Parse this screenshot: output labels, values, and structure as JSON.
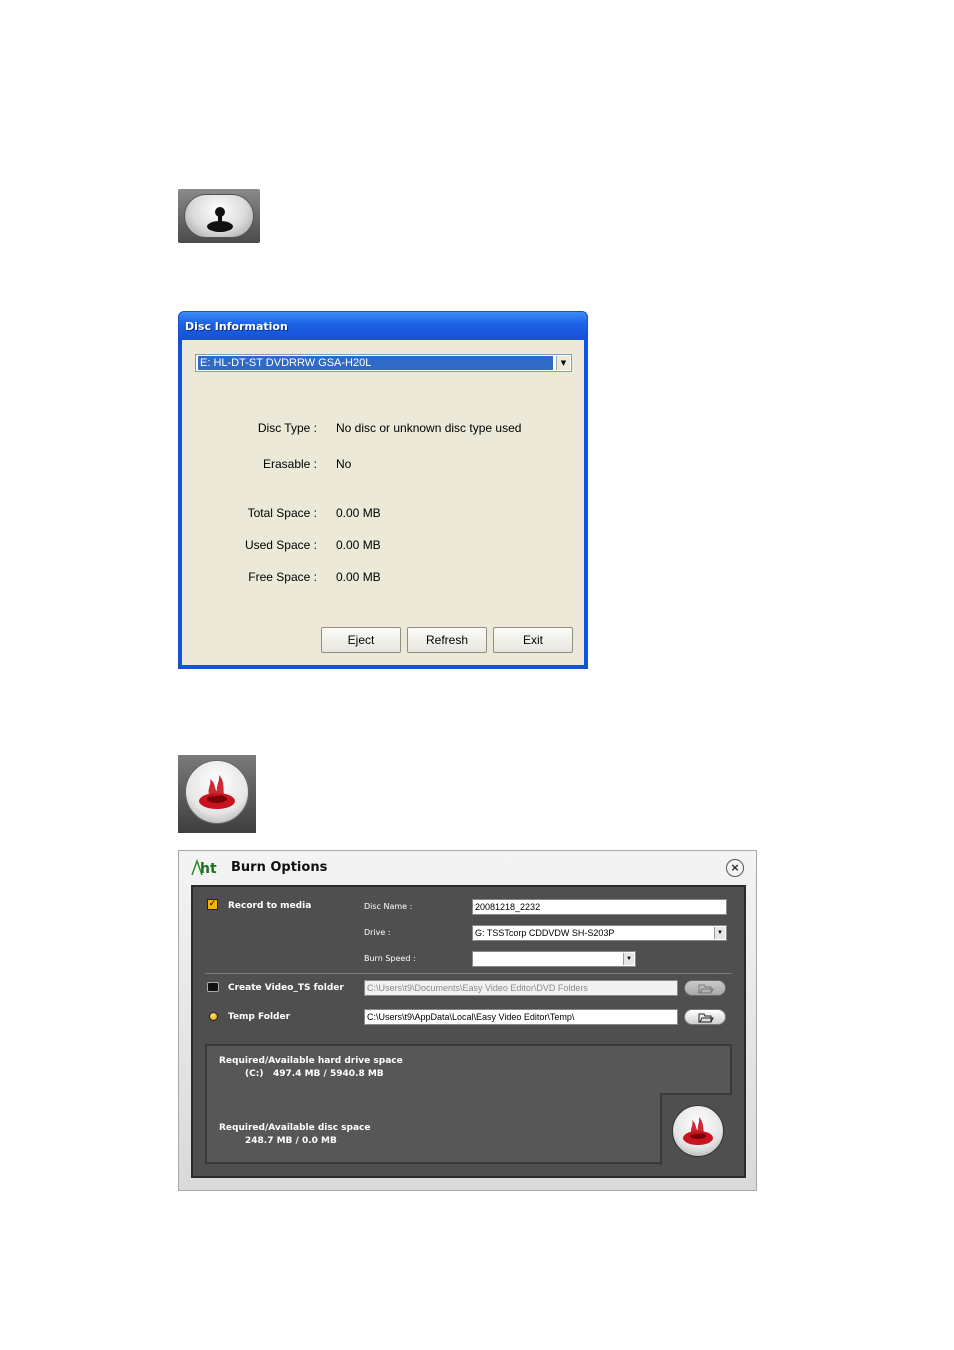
{
  "icons": {
    "disc_info": "disc-info-icon",
    "burn": "burn-flame-icon"
  },
  "disc_info_window": {
    "title": "Disc Information",
    "drive": "E: HL-DT-ST DVDRRW GSA-H20L",
    "labels": {
      "disc_type": "Disc Type :",
      "erasable": "Erasable :",
      "total_space": "Total Space :",
      "used_space": "Used Space :",
      "free_space": "Free Space :"
    },
    "values": {
      "disc_type": "No disc or unknown disc type used",
      "erasable": "No",
      "total_space": "0.00 MB",
      "used_space": "0.00 MB",
      "free_space": "0.00 MB"
    },
    "buttons": {
      "eject": "Eject",
      "refresh": "Refresh",
      "exit": "Exit"
    }
  },
  "burn_options": {
    "title": "Burn Options",
    "logo_text": "ht",
    "close_glyph": "×",
    "record_to_media": {
      "label": "Record to media",
      "checked": true
    },
    "disc_name": {
      "label": "Disc Name :",
      "value": "20081218_2232"
    },
    "drive": {
      "label": "Drive :",
      "value": "G: TSSTcorp CDDVDW SH-S203P"
    },
    "burn_speed": {
      "label": "Burn Speed :",
      "value": ""
    },
    "create_video_ts": {
      "label": "Create Video_TS folder",
      "path": "C:\\Users\\t9\\Documents\\Easy Video Editor\\DVD Folders"
    },
    "temp_folder": {
      "label": "Temp Folder",
      "path": "C:\\Users\\t9\\AppData\\Local\\Easy Video Editor\\Temp\\"
    },
    "hdd_space": {
      "title": "Required/Available hard drive space",
      "drive": "(C:)",
      "value": "497.4 MB / 5940.8 MB"
    },
    "disc_space": {
      "title": "Required/Available disc space",
      "value": "248.7 MB / 0.0 MB"
    }
  },
  "colors": {
    "xp_blue": "#0a55e8",
    "dialog_gray": "#ece9d8",
    "burn_panel": "#4f4f4f",
    "flame_red": "#c8141e"
  }
}
